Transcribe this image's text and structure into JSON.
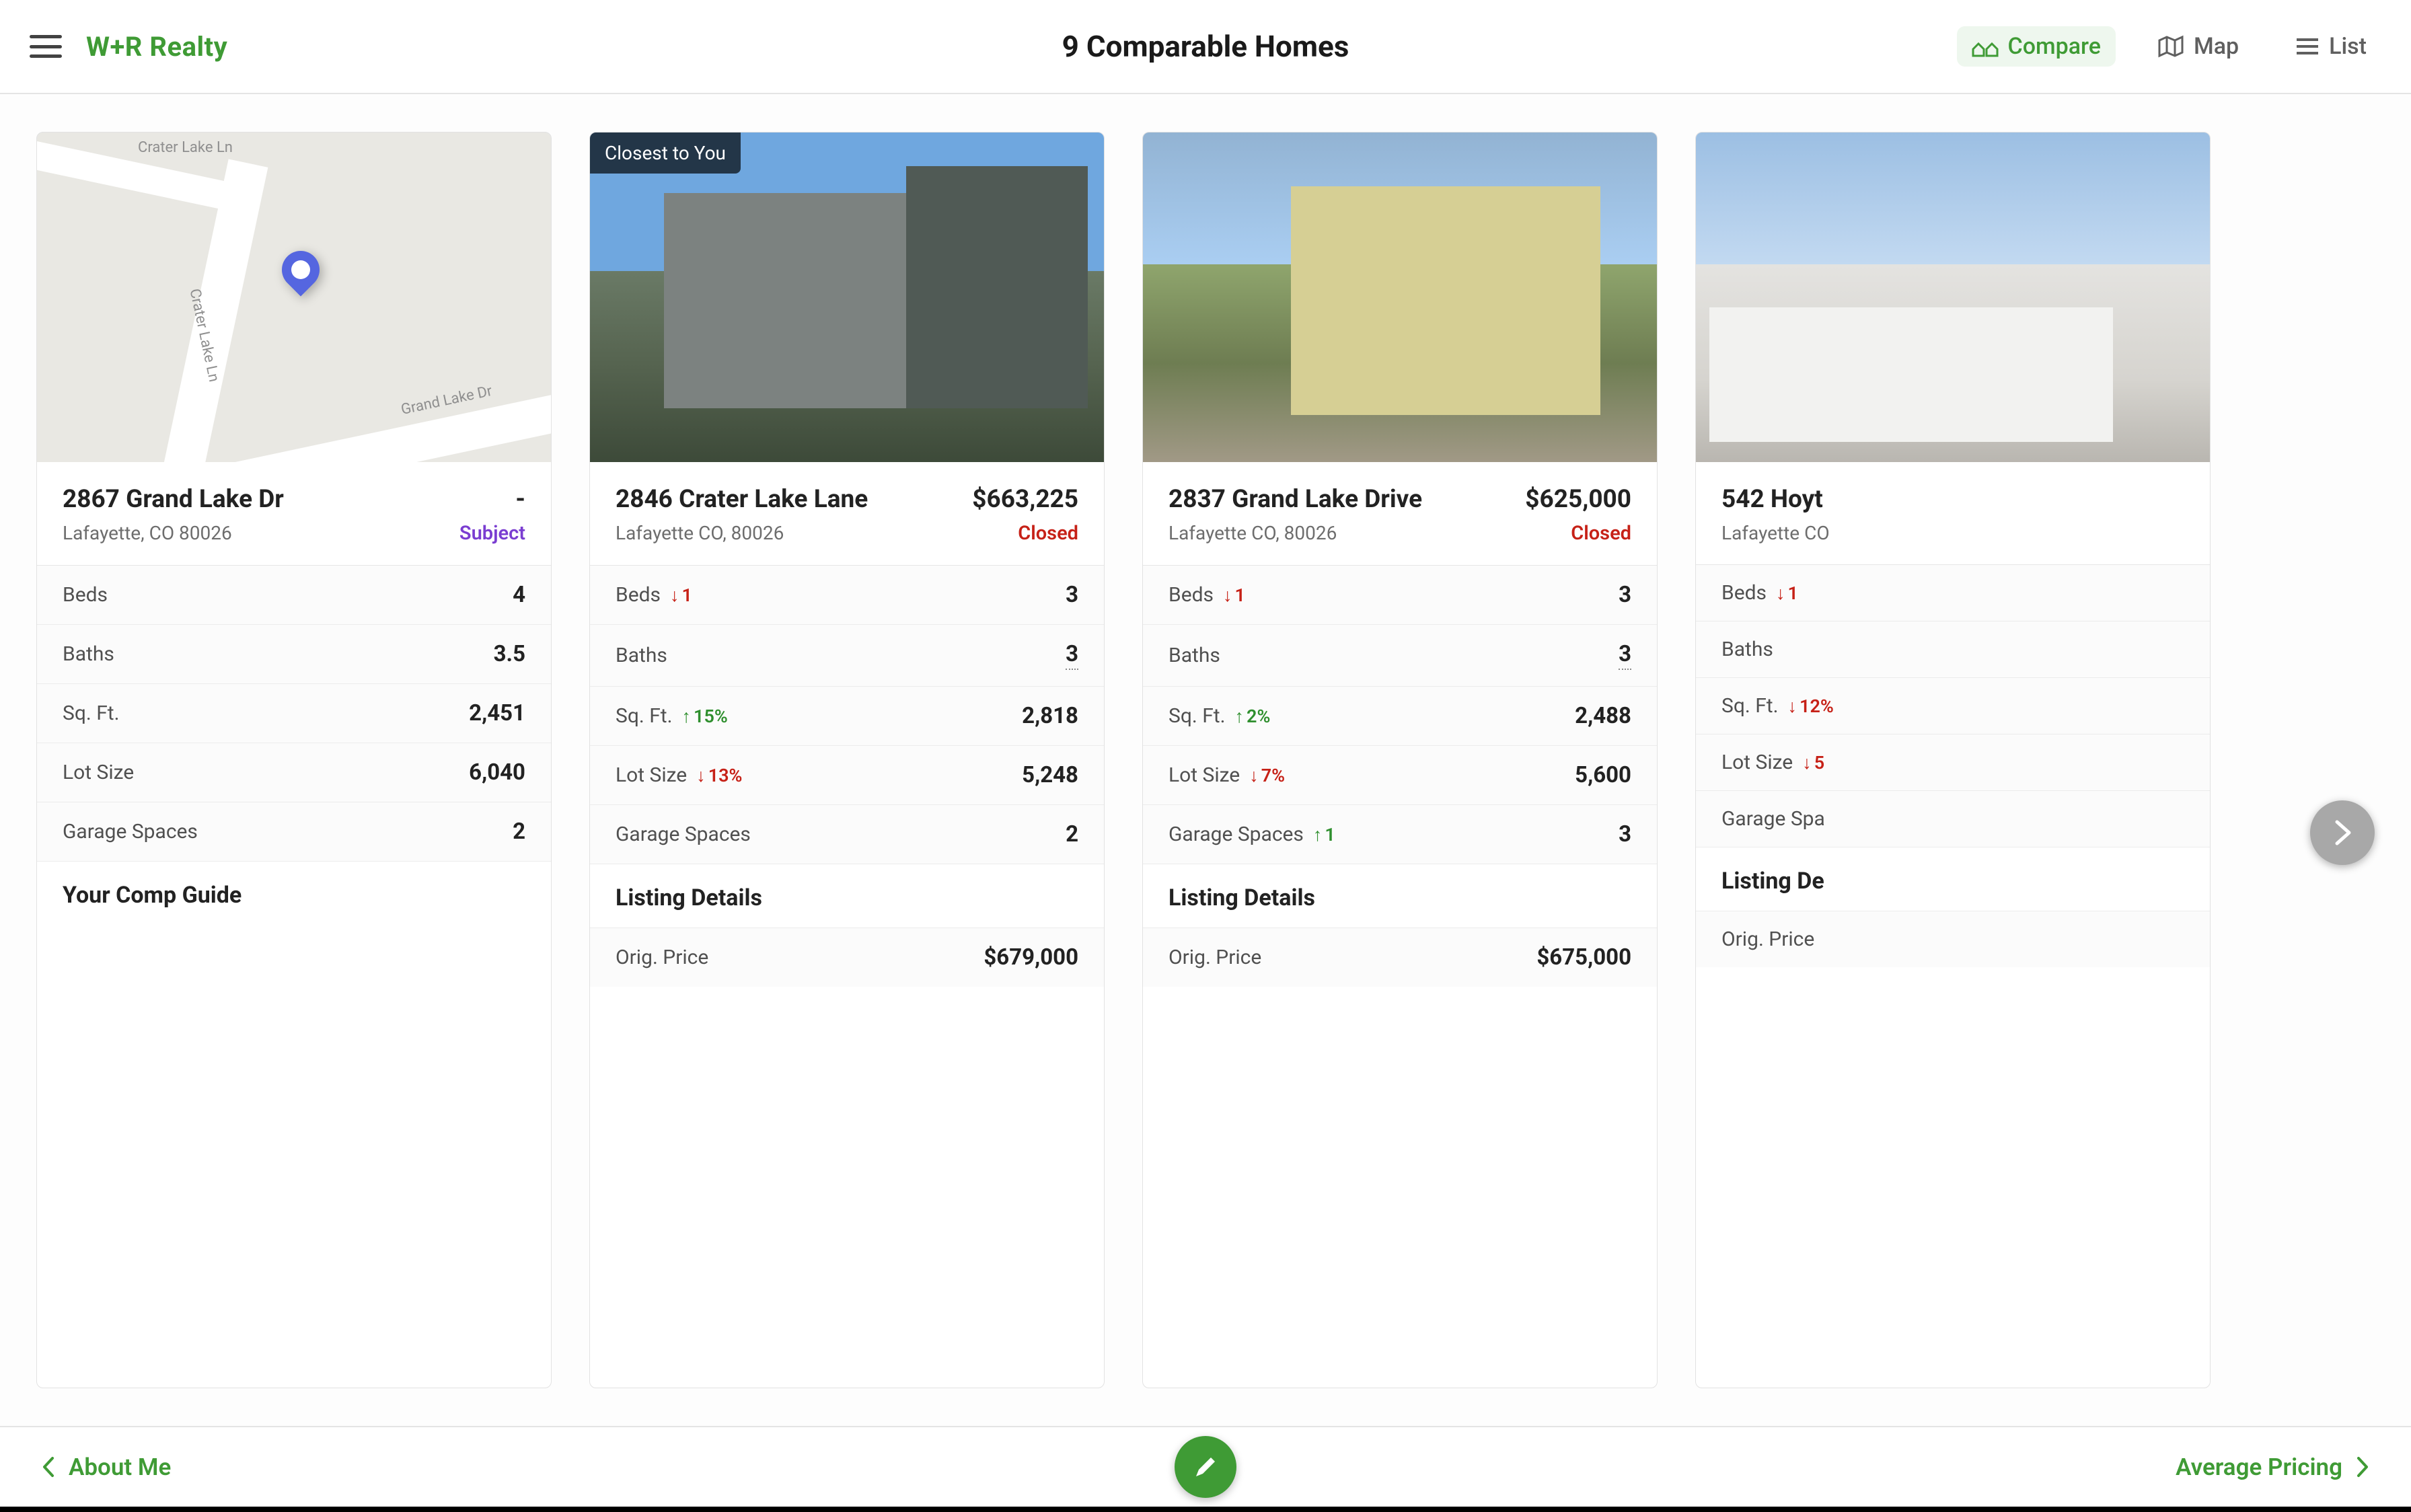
{
  "brand": "W+R Realty",
  "page_title": "9 Comparable Homes",
  "views": {
    "compare": "Compare",
    "map": "Map",
    "list": "List"
  },
  "map_labels": {
    "crater_top": "Crater Lake Ln",
    "crater_side": "Crater Lake Ln",
    "grand_lake": "Grand Lake Dr"
  },
  "cards": [
    {
      "address": "2867 Grand Lake Dr",
      "city": "Lafayette, CO 80026",
      "price": "-",
      "status": "Subject",
      "status_class": "subject",
      "badge": "",
      "specs": {
        "beds_label": "Beds",
        "beds_delta": "",
        "beds_dir": "",
        "beds_val": "4",
        "baths_label": "Baths",
        "baths_delta": "",
        "baths_dir": "",
        "baths_val": "3.5",
        "sqft_label": "Sq. Ft.",
        "sqft_delta": "",
        "sqft_dir": "",
        "sqft_val": "2,451",
        "lot_label": "Lot Size",
        "lot_delta": "",
        "lot_dir": "",
        "lot_val": "6,040",
        "garage_label": "Garage Spaces",
        "garage_delta": "",
        "garage_dir": "",
        "garage_val": "2"
      },
      "section": "Your Comp Guide",
      "detail1_label": "",
      "detail1_val": ""
    },
    {
      "address": "2846 Crater Lake Lane",
      "city": "Lafayette CO, 80026",
      "price": "$663,225",
      "status": "Closed",
      "status_class": "closed",
      "badge": "Closest to You",
      "specs": {
        "beds_label": "Beds",
        "beds_delta": "1",
        "beds_dir": "down",
        "beds_val": "3",
        "baths_label": "Baths",
        "baths_delta": "",
        "baths_dir": "",
        "baths_val": "3",
        "baths_dotted": true,
        "sqft_label": "Sq. Ft.",
        "sqft_delta": "15%",
        "sqft_dir": "up",
        "sqft_val": "2,818",
        "lot_label": "Lot Size",
        "lot_delta": "13%",
        "lot_dir": "down",
        "lot_val": "5,248",
        "garage_label": "Garage Spaces",
        "garage_delta": "",
        "garage_dir": "",
        "garage_val": "2"
      },
      "section": "Listing Details",
      "detail1_label": "Orig. Price",
      "detail1_val": "$679,000"
    },
    {
      "address": "2837 Grand Lake Drive",
      "city": "Lafayette CO, 80026",
      "price": "$625,000",
      "status": "Closed",
      "status_class": "closed",
      "badge": "",
      "specs": {
        "beds_label": "Beds",
        "beds_delta": "1",
        "beds_dir": "down",
        "beds_val": "3",
        "baths_label": "Baths",
        "baths_delta": "",
        "baths_dir": "",
        "baths_val": "3",
        "baths_dotted": true,
        "sqft_label": "Sq. Ft.",
        "sqft_delta": "2%",
        "sqft_dir": "up",
        "sqft_val": "2,488",
        "lot_label": "Lot Size",
        "lot_delta": "7%",
        "lot_dir": "down",
        "lot_val": "5,600",
        "garage_label": "Garage Spaces",
        "garage_delta": "1",
        "garage_dir": "up",
        "garage_val": "3"
      },
      "section": "Listing Details",
      "detail1_label": "Orig. Price",
      "detail1_val": "$675,000"
    },
    {
      "address": "542 Hoyt",
      "city": "Lafayette CO",
      "price": "",
      "status": "",
      "status_class": "",
      "badge": "",
      "specs": {
        "beds_label": "Beds",
        "beds_delta": "1",
        "beds_dir": "down",
        "beds_val": "",
        "baths_label": "Baths",
        "baths_delta": "",
        "baths_dir": "",
        "baths_val": "",
        "sqft_label": "Sq. Ft.",
        "sqft_delta": "12%",
        "sqft_dir": "down",
        "sqft_val": "",
        "lot_label": "Lot Size",
        "lot_delta": "5",
        "lot_dir": "down",
        "lot_val": "",
        "garage_label": "Garage Spa",
        "garage_delta": "",
        "garage_dir": "",
        "garage_val": ""
      },
      "section": "Listing De",
      "detail1_label": "Orig. Price",
      "detail1_val": ""
    }
  ],
  "footer": {
    "left": "About Me",
    "right": "Average Pricing"
  }
}
